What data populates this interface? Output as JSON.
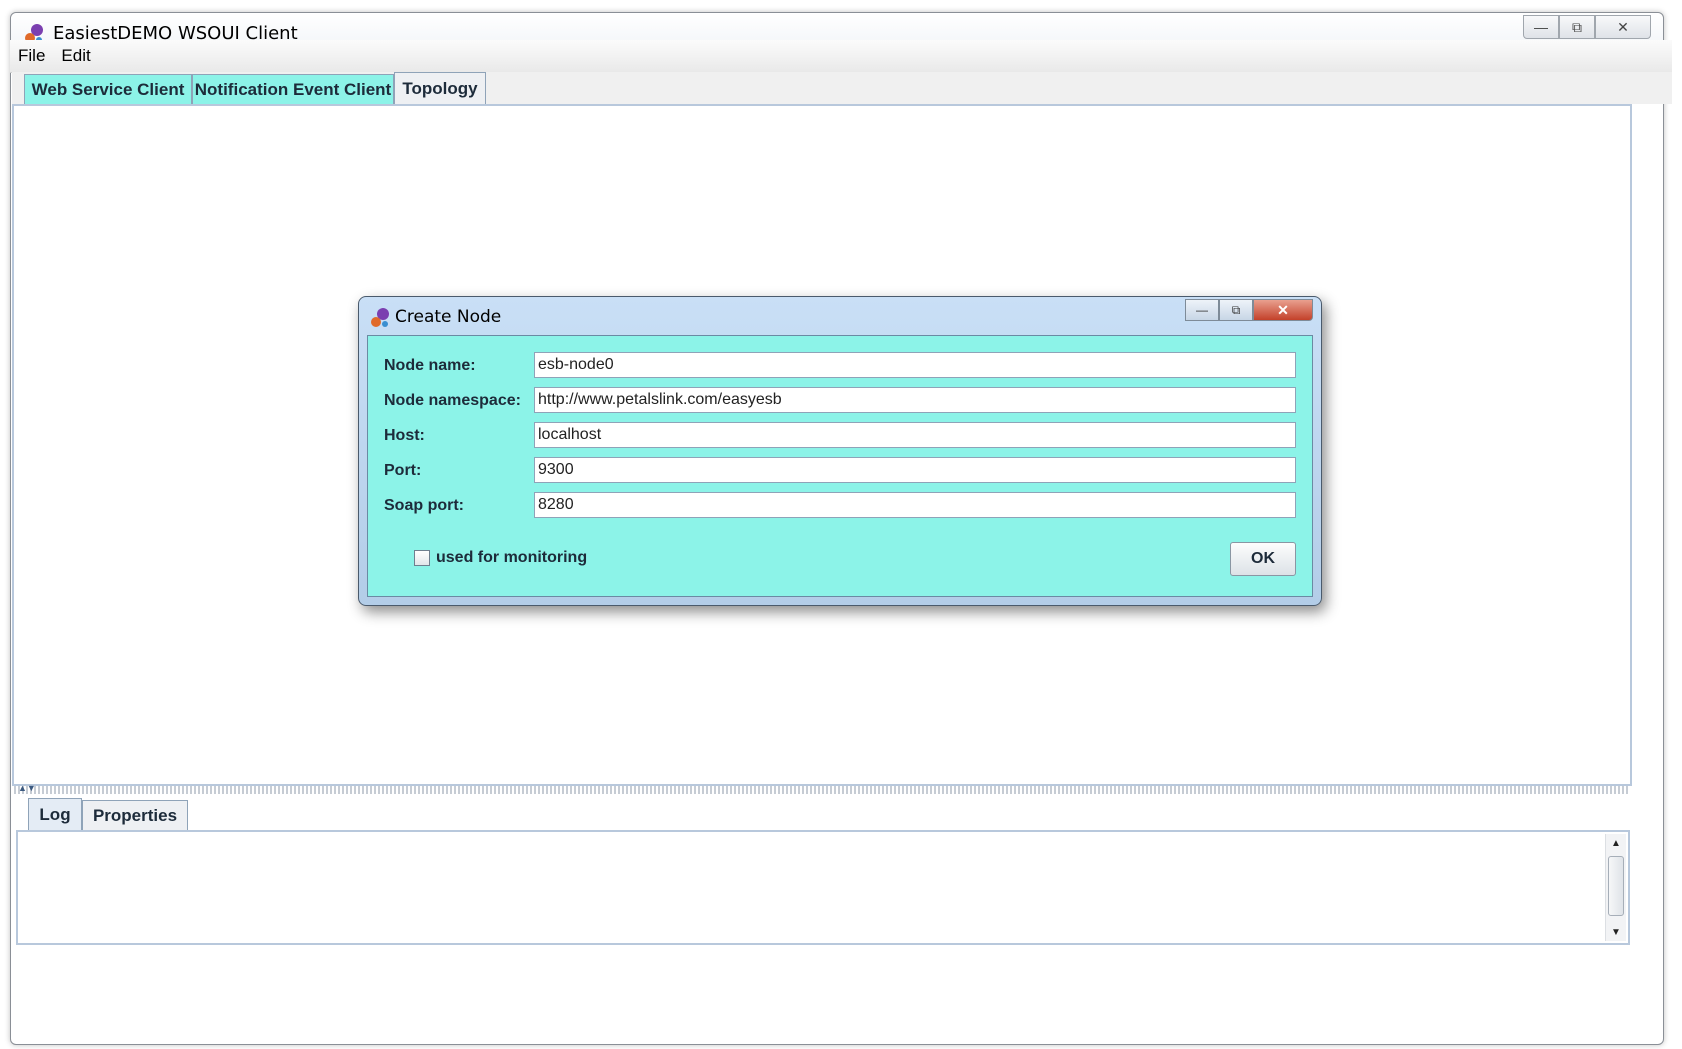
{
  "window": {
    "title": "EasiestDEMO WSOUI Client"
  },
  "menu": {
    "items": [
      "File",
      "Edit"
    ]
  },
  "tabs": [
    {
      "label": "Web Service Client",
      "active": false
    },
    {
      "label": "Notification Event Client",
      "active": false
    },
    {
      "label": "Topology",
      "active": true
    }
  ],
  "bottom_tabs": [
    {
      "label": "Log",
      "active": true
    },
    {
      "label": "Properties",
      "active": false
    }
  ],
  "dialog": {
    "title": "Create Node",
    "fields": [
      {
        "label": "Node name:",
        "value": "esb-node0"
      },
      {
        "label": "Node namespace:",
        "value": "http://www.petalslink.com/easyesb"
      },
      {
        "label": "Host:",
        "value": "localhost"
      },
      {
        "label": "Port:",
        "value": "9300"
      },
      {
        "label": "Soap port:",
        "value": "8280"
      }
    ],
    "checkbox_label": "used for monitoring",
    "checkbox_checked": false,
    "ok_label": "OK"
  },
  "colors": {
    "accent": "#8cf3e8",
    "dialog_title": "#b3cde8",
    "close_button": "#c3412a"
  }
}
